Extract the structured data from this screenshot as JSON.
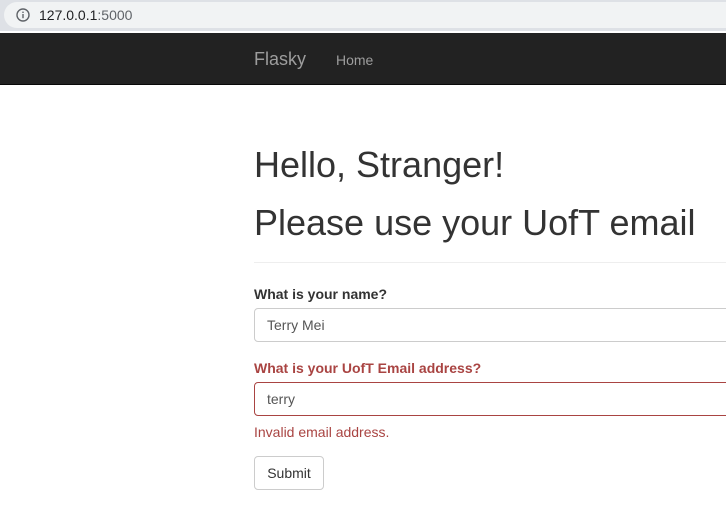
{
  "browser": {
    "url_host": "127.0.0.1",
    "url_port": ":5000",
    "icon": "info-icon"
  },
  "navbar": {
    "brand": "Flasky",
    "links": [
      {
        "label": "Home"
      }
    ]
  },
  "main": {
    "greeting": "Hello, Stranger!",
    "subheading": "Please use your UofT email"
  },
  "form": {
    "name_label": "What is your name?",
    "name_value": "Terry Mei",
    "email_label": "What is your UofT Email address?",
    "email_value": "terry",
    "email_error": "Invalid email address.",
    "submit_label": "Submit",
    "error_color": "#a94442"
  }
}
